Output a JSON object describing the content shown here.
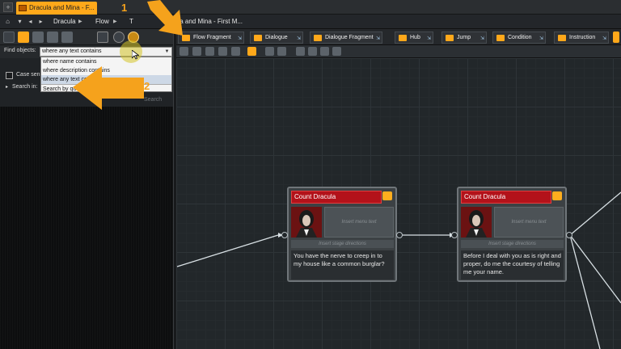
{
  "titlebar": {
    "new_tab": "+",
    "doc_tab": "Dracula and Mina - F..."
  },
  "breadcrumb": {
    "items": [
      "Dracula",
      "Flow",
      "T",
      "cula and Mina - First M..."
    ]
  },
  "finder": {
    "label": "Find objects:",
    "selected": "where any text contains",
    "options": [
      "where name contains",
      "where description contains",
      "where any text contains",
      "Search by query"
    ],
    "case_label": "Case sens",
    "search_in_label": "Search in:",
    "search_button": "Search"
  },
  "templates": [
    "Flow Fragment",
    "Dialogue",
    "Dialogue Fragment",
    "Hub",
    "Jump",
    "Condition",
    "Instruction"
  ],
  "annotations": {
    "step1": "1",
    "step2": "2"
  },
  "nodes": [
    {
      "speaker": "Count Dracula",
      "menu_placeholder": "Insert menu text",
      "stage_placeholder": "Insert stage directions",
      "text": "You have the nerve to creep in to my house like a common burglar?"
    },
    {
      "speaker": "Count Dracula",
      "menu_placeholder": "Insert menu text",
      "stage_placeholder": "Insert stage directions",
      "text": "Before I deal with you as is right and proper, do me the courtesy of telling me your name."
    }
  ],
  "colors": {
    "accent": "#ffa81a",
    "node_header": "#b3121a",
    "annotation": "#f5a21c"
  }
}
